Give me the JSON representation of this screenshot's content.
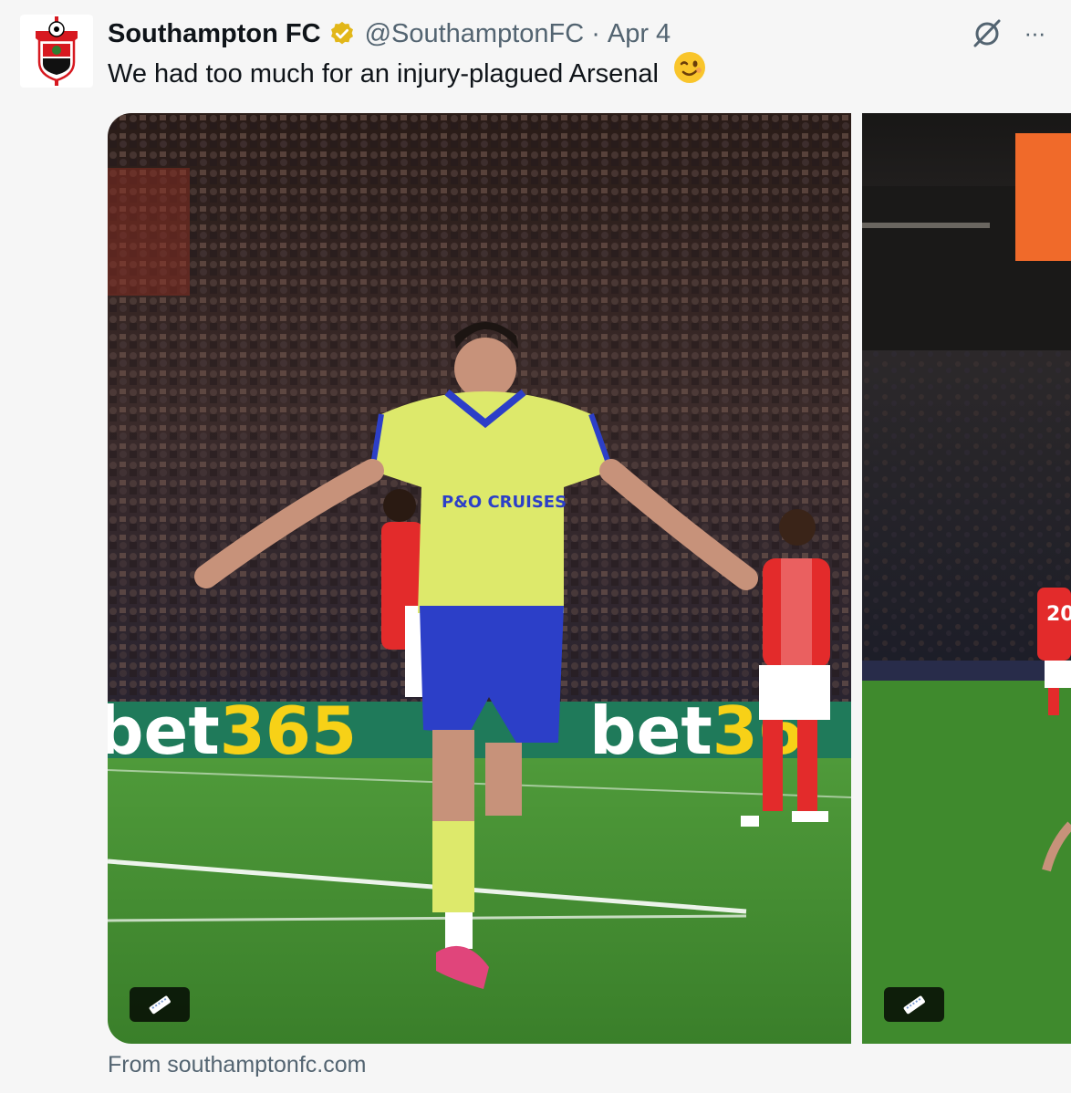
{
  "tweet": {
    "author_name": "Southampton FC",
    "handle": "@SouthamptonFC",
    "separator": "·",
    "date": "Apr 4",
    "text": "We had too much for an injury-plagued Arsenal",
    "emoji_icon": "winking-face",
    "more_label": "···",
    "source_text": "From southamptonfc.com"
  },
  "media": {
    "photo_1_crest_text": "P&O CRUISES",
    "ad_board_text": "bet365",
    "photo_2_shirt_number": "20"
  },
  "colors": {
    "verified_badge": "#e2b719",
    "pitch": "#3e8a2c",
    "kit_yellow": "#dde96b",
    "kit_blue": "#2c3fc8",
    "arsenal_red": "#e32b2b"
  }
}
